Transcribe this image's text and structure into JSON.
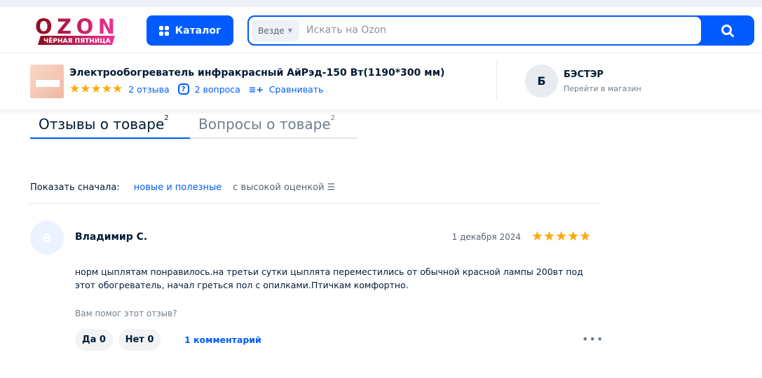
{
  "header": {
    "logo_text": "OZON",
    "logo_sub": "ЧЁРНАЯ ПЯТНИЦА",
    "catalog_label": "Каталог",
    "search_scope": "Везде",
    "search_placeholder": "Искать на Ozon"
  },
  "product": {
    "title": "Электрообогреватель инфракрасный АйРэд-150 Вт(1190*300 мм)",
    "rating_stars": 5,
    "reviews_link": "2 отзыва",
    "questions_link": "2 вопроса",
    "compare_link": "Сравнивать"
  },
  "seller": {
    "initial": "Б",
    "name": "БЭСТЭР",
    "link": "Перейти в магазин"
  },
  "tabs": [
    {
      "label": "Отзывы о товаре",
      "count": "2"
    },
    {
      "label": "Вопросы о товаре",
      "count": "2"
    }
  ],
  "sort": {
    "label": "Показать сначала:",
    "options": [
      "новые и полезные",
      "с высокой оценкой"
    ]
  },
  "review": {
    "initial": "В",
    "author": "Владимир С.",
    "date": "1 декабря 2024",
    "rating": 5,
    "text": "норм цыплятам понравилось.на третьи сутки цыплята переместились от обычной красной лампы 200вт под этот обогреватель, начал греться пол с опилками.Птичкам комфортно.",
    "helpful_question": "Вам помог этот отзыв?",
    "yes": "Да 0",
    "no": "Нет 0",
    "comments": "1 комментарий"
  },
  "colors": {
    "accent": "#005bff",
    "star": "#ffa800"
  }
}
